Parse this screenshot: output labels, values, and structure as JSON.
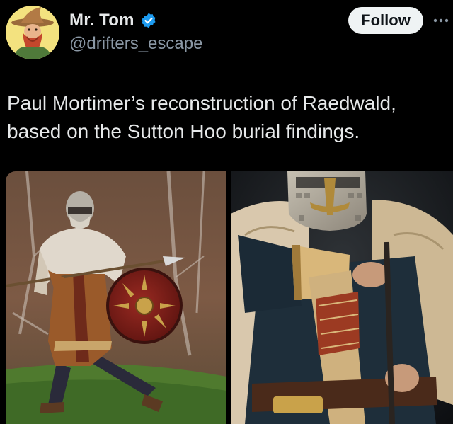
{
  "author": {
    "display_name": "Mr. Tom",
    "handle": "@drifters_escape",
    "verified": true,
    "avatar_icon": "wizard-avatar-icon"
  },
  "actions": {
    "follow_label": "Follow",
    "more_icon": "more-options-icon"
  },
  "tweet": {
    "text": "Paul Mortimer’s reconstruction of Raedwald, based on the Sutton Hoo burial findings."
  },
  "media": [
    {
      "icon": "photo-warrior-with-spear-and-shield"
    },
    {
      "icon": "photo-warrior-helmet-closeup"
    }
  ],
  "colors": {
    "background": "#000000",
    "text": "#e7e9ea",
    "secondary_text": "#8b98a5",
    "verified_blue": "#1d9bf0",
    "follow_bg": "#eff3f4",
    "follow_text": "#0f1419"
  }
}
